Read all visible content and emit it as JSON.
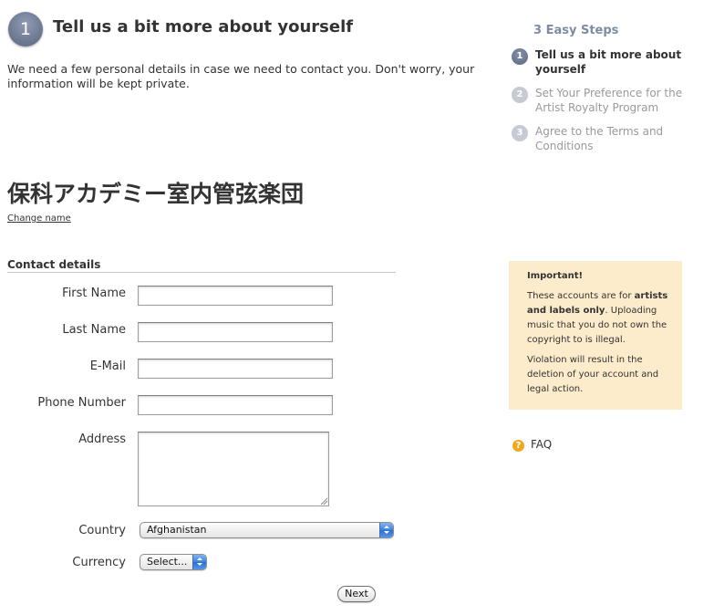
{
  "step": {
    "number": "1",
    "title": "Tell us a bit more about yourself"
  },
  "intro": "We need a few personal details in case we need to contact you. Don't worry, your information will be kept private.",
  "artist": {
    "name": "保科アカデミー室内管弦楽団",
    "change_link": "Change name"
  },
  "contact": {
    "section_title": "Contact details",
    "first_name": {
      "label": "First Name",
      "value": ""
    },
    "last_name": {
      "label": "Last Name",
      "value": ""
    },
    "email": {
      "label": "E-Mail",
      "value": ""
    },
    "phone": {
      "label": "Phone Number",
      "value": ""
    },
    "address": {
      "label": "Address",
      "value": ""
    },
    "country": {
      "label": "Country",
      "selected": "Afghanistan"
    },
    "currency": {
      "label": "Currency",
      "selected": "Select..."
    },
    "next_label": "Next"
  },
  "steps_panel": {
    "heading": "3 Easy Steps",
    "items": [
      {
        "number": "1",
        "label": "Tell us a bit more about yourself",
        "active": true
      },
      {
        "number": "2",
        "label": "Set Your Preference for the Artist Royalty Program",
        "active": false
      },
      {
        "number": "3",
        "label": "Agree to the Terms and Conditions",
        "active": false
      }
    ]
  },
  "notice": {
    "title": "Important!",
    "line1_before": "These accounts are for ",
    "line1_bold": "artists and labels only",
    "line1_after": ". Uploading music that you do not own the copyright to is illegal.",
    "line2": "Violation will result in the deletion of your account and legal action."
  },
  "faq": {
    "icon": "question-icon",
    "icon_glyph": "?",
    "label": "FAQ"
  },
  "colors": {
    "accent": "#7d8ba4",
    "notice_bg": "#fceccb",
    "faq_icon": "#f0a81e",
    "select_arrow": "#3d82dd"
  }
}
